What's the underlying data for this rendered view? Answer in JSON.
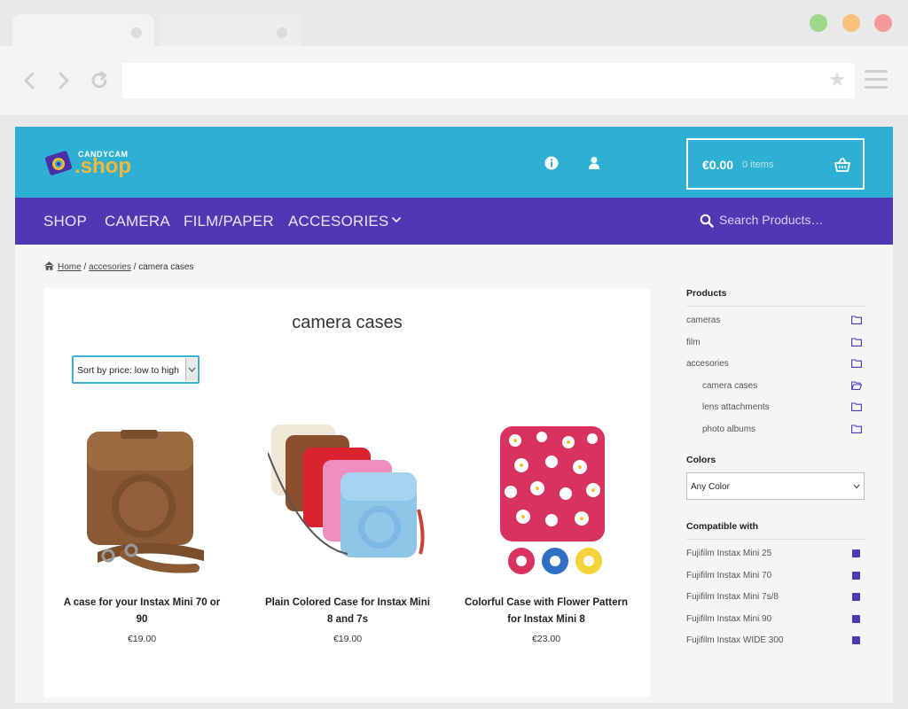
{
  "browser": {
    "window_buttons": [
      {
        "name": "minimize",
        "color": "#9fd88a"
      },
      {
        "name": "maximize",
        "color": "#f6c27a"
      },
      {
        "name": "close",
        "color": "#f29a9a"
      }
    ],
    "url": ""
  },
  "header": {
    "logo_small": "CANDYCAM",
    "logo_big": ".shop",
    "cart_total": "€0.00",
    "cart_items": "0 items"
  },
  "nav": {
    "items": [
      "SHOP",
      "CAMERA",
      "FILM/PAPER",
      "ACCESORIES"
    ],
    "search_placeholder": "Search Products…"
  },
  "breadcrumb": {
    "home": "Home",
    "sep1": "/",
    "accesories": "accesories",
    "sep2": "/",
    "current": "camera cases"
  },
  "main": {
    "title": "camera cases",
    "sort_label": "Sort by price: low to high",
    "products": [
      {
        "name": "A case for your Instax Mini 70 or 90",
        "price": "€19.00"
      },
      {
        "name": "Plain Colored Case for Instax Mini 8 and 7s",
        "price": "€19.00"
      },
      {
        "name": "Colorful Case with Flower Pattern for Instax Mini 8",
        "price": "€23.00"
      }
    ]
  },
  "sidebar": {
    "products_heading": "Products",
    "categories": [
      "cameras",
      "film",
      "accesories"
    ],
    "subcategories": [
      "camera cases",
      "lens attachments",
      "photo albums"
    ],
    "colors_heading": "Colors",
    "color_select": "Any Color",
    "compatible_heading": "Compatible with",
    "compatible": [
      "Fujifilm Instax Mini 25",
      "Fujifilm Instax Mini 70",
      "Fujifilm Instax Mini 7s/8",
      "Fujifilm Instax Mini 90",
      "Fujifilm Instax WIDE 300"
    ]
  },
  "colors": {
    "header_bg": "#2eb0d4",
    "nav_bg": "#5038b3",
    "accent_orange": "#f7b733"
  }
}
